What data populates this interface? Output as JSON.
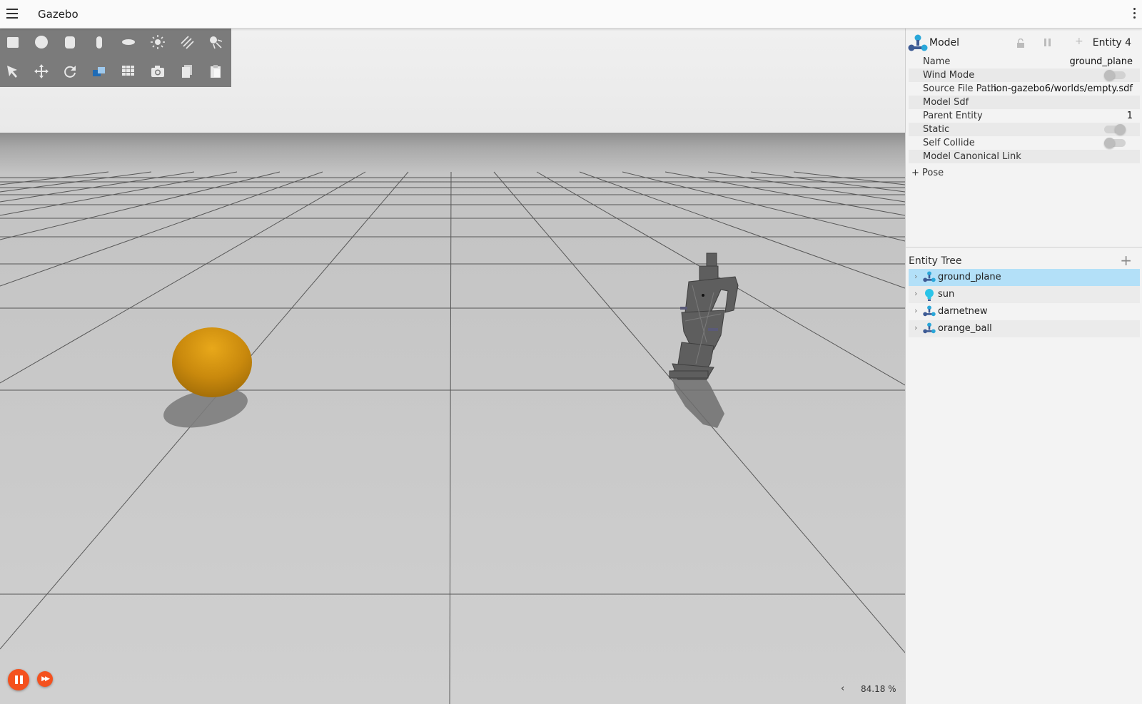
{
  "window": {
    "title": "Gazebo"
  },
  "toolbar": {
    "shapes": [
      "box-icon",
      "sphere-icon",
      "cylinder-icon",
      "capsule-icon",
      "ellipsoid-icon",
      "point-light-icon",
      "directional-light-icon",
      "spot-light-icon"
    ],
    "transforms": [
      "select-icon",
      "translate-icon",
      "rotate-icon",
      "view-angle-icon",
      "grid-snap-icon",
      "screenshot-icon",
      "copy-icon",
      "paste-icon"
    ]
  },
  "playback": {
    "real_time_factor": "84.18 %",
    "collapse_glyph": "‹"
  },
  "component_inspector": {
    "title": "Model",
    "entity_label": "Entity 4",
    "properties": {
      "name": {
        "label": "Name",
        "value": "ground_plane"
      },
      "wind_mode": {
        "label": "Wind Mode",
        "enabled": false
      },
      "source_file_path": {
        "label": "Source File Path",
        "value": "…ion-gazebo6/worlds/empty.sdf"
      },
      "model_sdf": {
        "label": "Model Sdf"
      },
      "parent_entity": {
        "label": "Parent Entity",
        "value": "1"
      },
      "static": {
        "label": "Static",
        "enabled": true
      },
      "self_collide": {
        "label": "Self Collide",
        "enabled": false
      },
      "canonical_link": {
        "label": "Model Canonical Link"
      }
    },
    "pose": {
      "expander": "+",
      "label": "Pose"
    }
  },
  "entity_tree": {
    "title": "Entity Tree",
    "add_glyph": "+",
    "items": [
      {
        "label": "ground_plane",
        "icon": "model-icon",
        "selected": true
      },
      {
        "label": "sun",
        "icon": "light-bulb-icon",
        "selected": false
      },
      {
        "label": "darnetnew",
        "icon": "model-icon",
        "selected": false
      },
      {
        "label": "orange_ball",
        "icon": "model-icon",
        "selected": false
      }
    ]
  },
  "colors": {
    "accent_orange": "#f4511e",
    "selection_blue": "#b3e0f8",
    "ball": "#d99a10",
    "toolbar": "#7b7b7b"
  }
}
